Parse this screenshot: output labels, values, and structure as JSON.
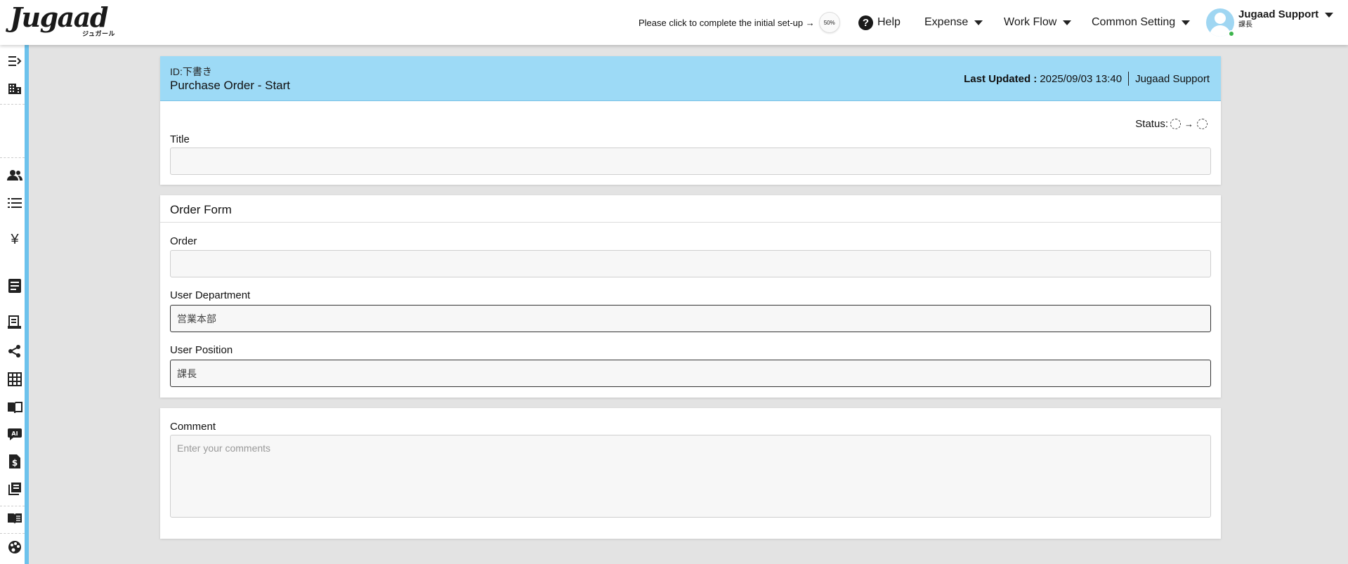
{
  "header": {
    "logo_text": "Jugaad",
    "logo_sub": "ジュガール",
    "setup_text": "Please click to complete the initial set-up →",
    "setup_progress": "50%",
    "help_label": "Help",
    "nav": [
      {
        "label": "Expense"
      },
      {
        "label": "Work Flow"
      },
      {
        "label": "Common Setting"
      }
    ],
    "user_name": "Jugaad Support",
    "user_role": "課長"
  },
  "sidebar": {
    "icons": [
      "collapse-sidebar-icon",
      "company-icon",
      "users-icon",
      "list-icon",
      "yen-icon",
      "document-icon",
      "receipt-icon",
      "share-icon",
      "grid-icon",
      "book-open-icon",
      "ai-chat-icon",
      "invoice-icon",
      "library-icon",
      "manual-icon",
      "palette-icon"
    ]
  },
  "document": {
    "id_label": "ID:",
    "id_value": "下書き",
    "title": "Purchase Order - Start",
    "last_updated_label": "Last Updated :",
    "last_updated_value": "2025/09/03 13:40",
    "updated_by": "Jugaad Support",
    "status_label": "Status:",
    "status_arrow": "→"
  },
  "fields": {
    "title_label": "Title",
    "title_value": ""
  },
  "order_form": {
    "section_title": "Order Form",
    "order_label": "Order",
    "order_value": "",
    "department_label": "User Department",
    "department_value": "営業本部",
    "position_label": "User Position",
    "position_value": "課長"
  },
  "comment": {
    "label": "Comment",
    "placeholder": "Enter your comments"
  },
  "colors": {
    "accent": "#6cc2ec",
    "card_header": "#9ddaf6",
    "online": "#3cb44b"
  }
}
